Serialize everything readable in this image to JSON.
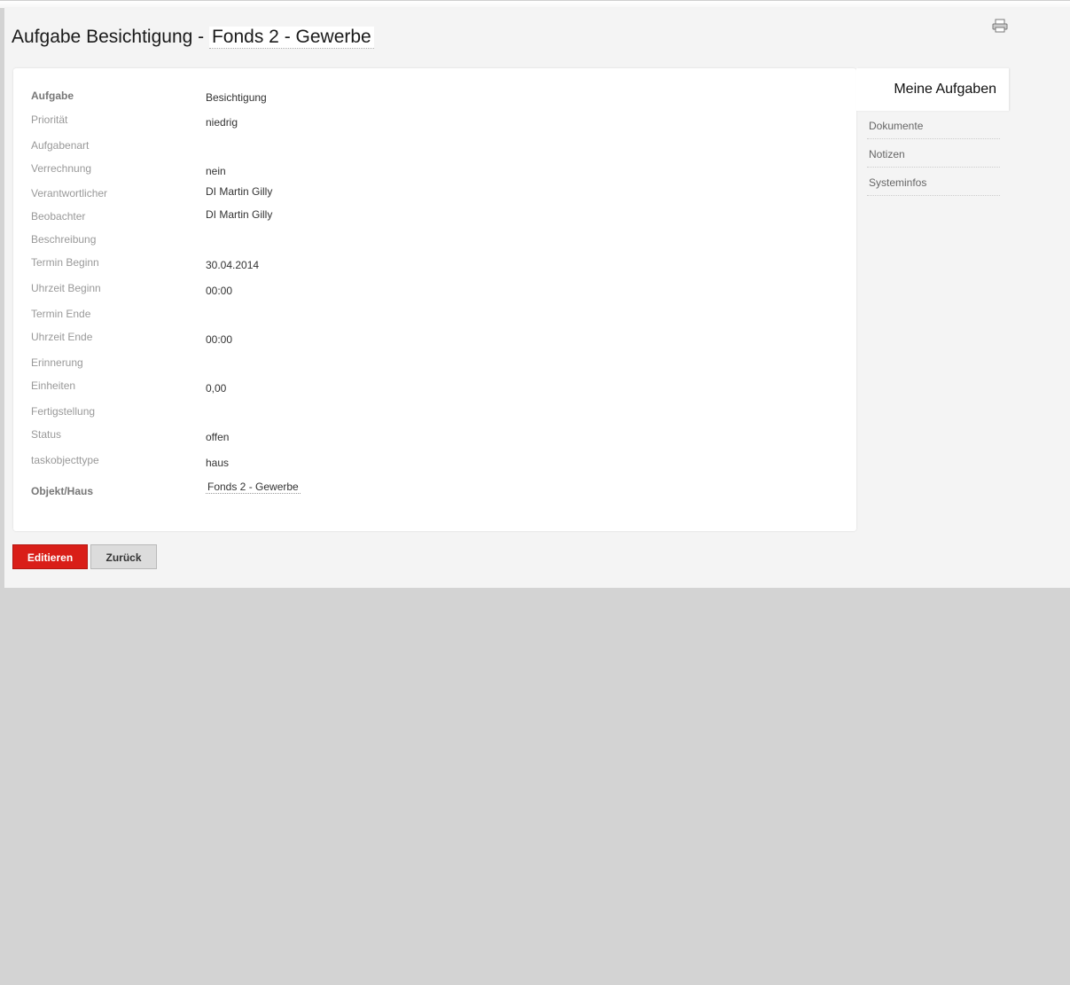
{
  "title": {
    "prefix": "Aufgabe Besichtigung - ",
    "object": "Fonds 2 - Gewerbe"
  },
  "fields": [
    {
      "label": "Aufgabe",
      "value": "Besichtigung"
    },
    {
      "label": "Priorität",
      "value": "niedrig"
    },
    {
      "label": "Aufgabenart",
      "value": ""
    },
    {
      "label": "Verrechnung",
      "value": "nein"
    },
    {
      "label": "Verantwortlicher",
      "value": "DI Martin Gilly"
    },
    {
      "label": "Beobachter",
      "value": "DI Martin Gilly"
    },
    {
      "label": "Beschreibung",
      "value": ""
    },
    {
      "label": "Termin Beginn",
      "value": "30.04.2014"
    },
    {
      "label": "Uhrzeit Beginn",
      "value": "00:00"
    },
    {
      "label": "Termin Ende",
      "value": ""
    },
    {
      "label": "Uhrzeit Ende",
      "value": "00:00"
    },
    {
      "label": "Erinnerung",
      "value": ""
    },
    {
      "label": "Einheiten",
      "value": "0,00"
    },
    {
      "label": "Fertigstellung",
      "value": ""
    },
    {
      "label": "Status",
      "value": "offen"
    },
    {
      "label": "taskobjecttype",
      "value": "haus"
    },
    {
      "label": "Objekt/Haus",
      "value": "Fonds 2 - Gewerbe"
    }
  ],
  "sidebar": {
    "heading": "Meine Aufgaben",
    "items": [
      "Dokumente",
      "Notizen",
      "Systeminfos"
    ]
  },
  "buttons": {
    "edit": "Editieren",
    "back": "Zurück"
  },
  "colors": {
    "accent": "#d91e18",
    "background": "#d3d3d3",
    "panel": "#f4f4f4"
  },
  "icons": {
    "print": "printer-icon"
  }
}
